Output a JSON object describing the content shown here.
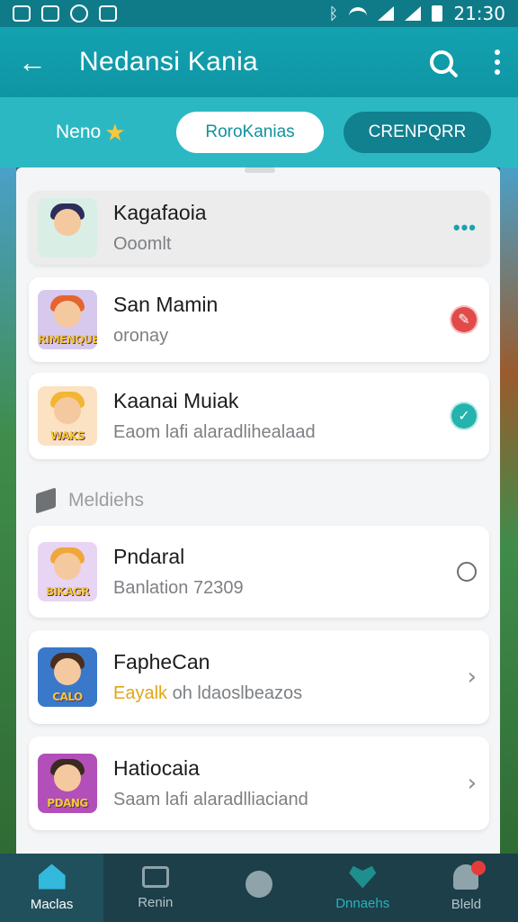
{
  "status_bar": {
    "time": "21:30"
  },
  "app_bar": {
    "title": "Nedansi Kania"
  },
  "tabs": [
    {
      "label": "Neno"
    },
    {
      "label": "RoroKanias"
    },
    {
      "label": "CRENPQRR"
    }
  ],
  "list": [
    {
      "name": "Kagafaoia",
      "subtitle": "Ooomlt",
      "status": "menu",
      "avatar_color": "#d9efe6",
      "tag": ""
    },
    {
      "name": "San Mamin",
      "subtitle": "oronay",
      "status": "alert",
      "avatar_color": "#d7c9ee",
      "tag": "RIMENQUE"
    },
    {
      "name": "Kaanai Muiak",
      "subtitle": "Eaom lafi alaradlihealaad",
      "status": "done",
      "avatar_color": "#fbe2c2",
      "tag": "WAKS"
    }
  ],
  "section": {
    "label": "Meldiehs"
  },
  "section_list": [
    {
      "name": "Pndaral",
      "subtitle": "Banlation 72309",
      "status": "empty",
      "avatar_color": "#e7d5f3",
      "tag": "BIKAGR"
    },
    {
      "name": "FapheCan",
      "subtitle_highlight": "Eayalk",
      "subtitle": "oh ldaoslbeazos",
      "status": "chevron",
      "avatar_color": "#3a78c9",
      "tag": "CALO"
    },
    {
      "name": "Hatiocaia",
      "subtitle": "Saam lafi alaradlliaciand",
      "status": "chevron",
      "avatar_color": "#b24fb8",
      "tag": "PDANG"
    }
  ],
  "bottom_nav": [
    {
      "label": "Maclas",
      "icon": "home-icon"
    },
    {
      "label": "Renin",
      "icon": "chat-icon"
    },
    {
      "label": "",
      "icon": "globe-icon"
    },
    {
      "label": "Dnnaehs",
      "icon": "heart-icon"
    },
    {
      "label": "Bleld",
      "icon": "person-icon"
    }
  ],
  "colors": {
    "primary": "#13a2b0",
    "accent": "#25b3ae",
    "alert": "#e24a4a",
    "nav": "#1c3f49"
  }
}
